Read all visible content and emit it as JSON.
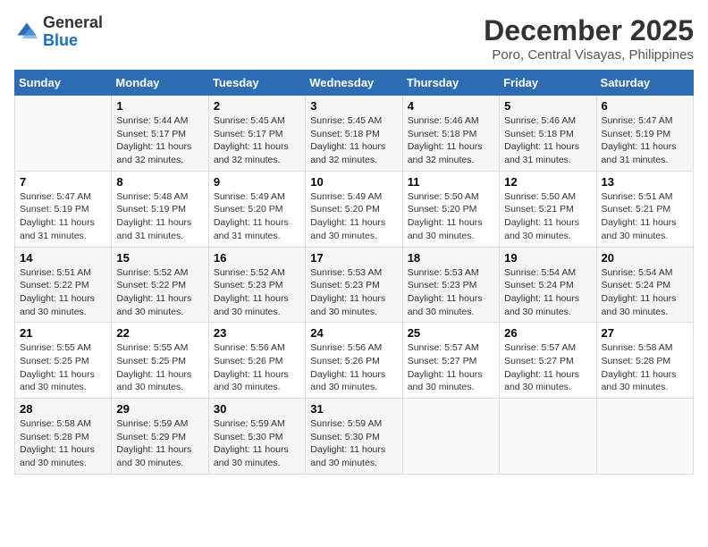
{
  "header": {
    "logo_general": "General",
    "logo_blue": "Blue",
    "month_title": "December 2025",
    "location": "Poro, Central Visayas, Philippines"
  },
  "days_of_week": [
    "Sunday",
    "Monday",
    "Tuesday",
    "Wednesday",
    "Thursday",
    "Friday",
    "Saturday"
  ],
  "weeks": [
    [
      {
        "day": "",
        "sunrise": "",
        "sunset": "",
        "daylight": ""
      },
      {
        "day": "1",
        "sunrise": "Sunrise: 5:44 AM",
        "sunset": "Sunset: 5:17 PM",
        "daylight": "Daylight: 11 hours and 32 minutes."
      },
      {
        "day": "2",
        "sunrise": "Sunrise: 5:45 AM",
        "sunset": "Sunset: 5:17 PM",
        "daylight": "Daylight: 11 hours and 32 minutes."
      },
      {
        "day": "3",
        "sunrise": "Sunrise: 5:45 AM",
        "sunset": "Sunset: 5:18 PM",
        "daylight": "Daylight: 11 hours and 32 minutes."
      },
      {
        "day": "4",
        "sunrise": "Sunrise: 5:46 AM",
        "sunset": "Sunset: 5:18 PM",
        "daylight": "Daylight: 11 hours and 32 minutes."
      },
      {
        "day": "5",
        "sunrise": "Sunrise: 5:46 AM",
        "sunset": "Sunset: 5:18 PM",
        "daylight": "Daylight: 11 hours and 31 minutes."
      },
      {
        "day": "6",
        "sunrise": "Sunrise: 5:47 AM",
        "sunset": "Sunset: 5:19 PM",
        "daylight": "Daylight: 11 hours and 31 minutes."
      }
    ],
    [
      {
        "day": "7",
        "sunrise": "Sunrise: 5:47 AM",
        "sunset": "Sunset: 5:19 PM",
        "daylight": "Daylight: 11 hours and 31 minutes."
      },
      {
        "day": "8",
        "sunrise": "Sunrise: 5:48 AM",
        "sunset": "Sunset: 5:19 PM",
        "daylight": "Daylight: 11 hours and 31 minutes."
      },
      {
        "day": "9",
        "sunrise": "Sunrise: 5:49 AM",
        "sunset": "Sunset: 5:20 PM",
        "daylight": "Daylight: 11 hours and 31 minutes."
      },
      {
        "day": "10",
        "sunrise": "Sunrise: 5:49 AM",
        "sunset": "Sunset: 5:20 PM",
        "daylight": "Daylight: 11 hours and 30 minutes."
      },
      {
        "day": "11",
        "sunrise": "Sunrise: 5:50 AM",
        "sunset": "Sunset: 5:20 PM",
        "daylight": "Daylight: 11 hours and 30 minutes."
      },
      {
        "day": "12",
        "sunrise": "Sunrise: 5:50 AM",
        "sunset": "Sunset: 5:21 PM",
        "daylight": "Daylight: 11 hours and 30 minutes."
      },
      {
        "day": "13",
        "sunrise": "Sunrise: 5:51 AM",
        "sunset": "Sunset: 5:21 PM",
        "daylight": "Daylight: 11 hours and 30 minutes."
      }
    ],
    [
      {
        "day": "14",
        "sunrise": "Sunrise: 5:51 AM",
        "sunset": "Sunset: 5:22 PM",
        "daylight": "Daylight: 11 hours and 30 minutes."
      },
      {
        "day": "15",
        "sunrise": "Sunrise: 5:52 AM",
        "sunset": "Sunset: 5:22 PM",
        "daylight": "Daylight: 11 hours and 30 minutes."
      },
      {
        "day": "16",
        "sunrise": "Sunrise: 5:52 AM",
        "sunset": "Sunset: 5:23 PM",
        "daylight": "Daylight: 11 hours and 30 minutes."
      },
      {
        "day": "17",
        "sunrise": "Sunrise: 5:53 AM",
        "sunset": "Sunset: 5:23 PM",
        "daylight": "Daylight: 11 hours and 30 minutes."
      },
      {
        "day": "18",
        "sunrise": "Sunrise: 5:53 AM",
        "sunset": "Sunset: 5:23 PM",
        "daylight": "Daylight: 11 hours and 30 minutes."
      },
      {
        "day": "19",
        "sunrise": "Sunrise: 5:54 AM",
        "sunset": "Sunset: 5:24 PM",
        "daylight": "Daylight: 11 hours and 30 minutes."
      },
      {
        "day": "20",
        "sunrise": "Sunrise: 5:54 AM",
        "sunset": "Sunset: 5:24 PM",
        "daylight": "Daylight: 11 hours and 30 minutes."
      }
    ],
    [
      {
        "day": "21",
        "sunrise": "Sunrise: 5:55 AM",
        "sunset": "Sunset: 5:25 PM",
        "daylight": "Daylight: 11 hours and 30 minutes."
      },
      {
        "day": "22",
        "sunrise": "Sunrise: 5:55 AM",
        "sunset": "Sunset: 5:25 PM",
        "daylight": "Daylight: 11 hours and 30 minutes."
      },
      {
        "day": "23",
        "sunrise": "Sunrise: 5:56 AM",
        "sunset": "Sunset: 5:26 PM",
        "daylight": "Daylight: 11 hours and 30 minutes."
      },
      {
        "day": "24",
        "sunrise": "Sunrise: 5:56 AM",
        "sunset": "Sunset: 5:26 PM",
        "daylight": "Daylight: 11 hours and 30 minutes."
      },
      {
        "day": "25",
        "sunrise": "Sunrise: 5:57 AM",
        "sunset": "Sunset: 5:27 PM",
        "daylight": "Daylight: 11 hours and 30 minutes."
      },
      {
        "day": "26",
        "sunrise": "Sunrise: 5:57 AM",
        "sunset": "Sunset: 5:27 PM",
        "daylight": "Daylight: 11 hours and 30 minutes."
      },
      {
        "day": "27",
        "sunrise": "Sunrise: 5:58 AM",
        "sunset": "Sunset: 5:28 PM",
        "daylight": "Daylight: 11 hours and 30 minutes."
      }
    ],
    [
      {
        "day": "28",
        "sunrise": "Sunrise: 5:58 AM",
        "sunset": "Sunset: 5:28 PM",
        "daylight": "Daylight: 11 hours and 30 minutes."
      },
      {
        "day": "29",
        "sunrise": "Sunrise: 5:59 AM",
        "sunset": "Sunset: 5:29 PM",
        "daylight": "Daylight: 11 hours and 30 minutes."
      },
      {
        "day": "30",
        "sunrise": "Sunrise: 5:59 AM",
        "sunset": "Sunset: 5:30 PM",
        "daylight": "Daylight: 11 hours and 30 minutes."
      },
      {
        "day": "31",
        "sunrise": "Sunrise: 5:59 AM",
        "sunset": "Sunset: 5:30 PM",
        "daylight": "Daylight: 11 hours and 30 minutes."
      },
      {
        "day": "",
        "sunrise": "",
        "sunset": "",
        "daylight": ""
      },
      {
        "day": "",
        "sunrise": "",
        "sunset": "",
        "daylight": ""
      },
      {
        "day": "",
        "sunrise": "",
        "sunset": "",
        "daylight": ""
      }
    ]
  ]
}
